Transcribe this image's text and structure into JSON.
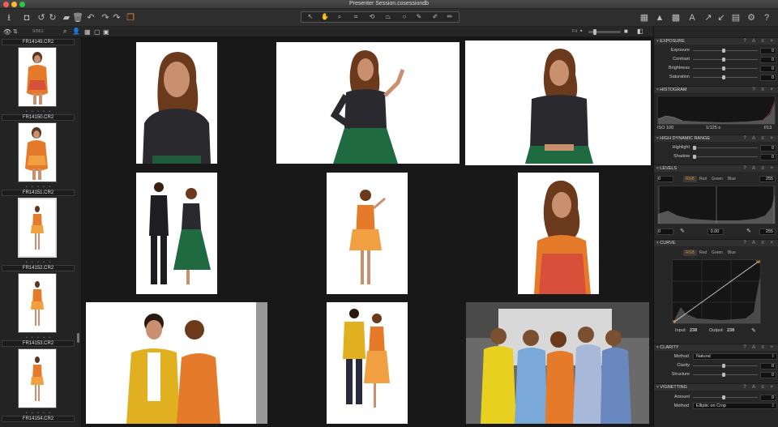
{
  "window": {
    "title": "Presenter Session.cosessiondb"
  },
  "toolbar": {
    "left_icons": [
      "import-icon",
      "capture-icon",
      "rotate-left-icon",
      "rotate-right-icon",
      "camera-icon",
      "trash-icon",
      "undo-icon",
      "redo-icon",
      "redo-alt-icon",
      "variants-icon"
    ],
    "cursor_tools": [
      "select-cursor-icon",
      "pan-hand-icon",
      "loupe-icon",
      "crop-icon",
      "rotate-tool-icon",
      "keystone-icon",
      "spot-icon",
      "color-picker-icon",
      "brush-icon",
      "eraser-icon"
    ],
    "right_icons": [
      "grid-view-icon",
      "warning-icon",
      "grid-icon",
      "text-icon",
      "copy-adjustments-icon",
      "apply-adjustments-icon",
      "print-icon",
      "settings-icon",
      "help-icon"
    ]
  },
  "subbar": {
    "count": "9/861",
    "fit_label": "Fit"
  },
  "browser": {
    "items": [
      {
        "name": "FR14149.CR2",
        "stars": "• • • • •"
      },
      {
        "name": "FR14150.CR2",
        "stars": "• • • • •"
      },
      {
        "name": "FR14151.CR2",
        "stars": "• • • • •"
      },
      {
        "name": "FR14152.CR2",
        "stars": "• • • • •"
      },
      {
        "name": "FR14153.CR2",
        "stars": "• • • • •"
      },
      {
        "name": "FR14154.CR2",
        "stars": ""
      }
    ]
  },
  "panels": {
    "exposure": {
      "title": "EXPOSURE",
      "rows": [
        {
          "label": "Exposure",
          "value": "0"
        },
        {
          "label": "Contrast",
          "value": "0"
        },
        {
          "label": "Brightness",
          "value": "0"
        },
        {
          "label": "Saturation",
          "value": "0"
        }
      ]
    },
    "histogram": {
      "title": "HISTOGRAM",
      "iso": "ISO 100",
      "shutter": "1/125 s",
      "aperture": "f/13"
    },
    "hdr": {
      "title": "HIGH DYNAMIC RANGE",
      "rows": [
        {
          "label": "Highlight",
          "value": "0"
        },
        {
          "label": "Shadow",
          "value": "0"
        }
      ]
    },
    "levels": {
      "title": "LEVELS",
      "low": "0",
      "high": "255",
      "tabs": [
        "RGB",
        "Red",
        "Green",
        "Blue"
      ],
      "out_low": "0",
      "mid": "0.00",
      "out_high": "255"
    },
    "curve": {
      "title": "CURVE",
      "tabs": [
        "RGB",
        "Red",
        "Green",
        "Blue"
      ],
      "input_label": "Input:",
      "input_value": "238",
      "output_label": "Output:",
      "output_value": "238"
    },
    "clarity": {
      "title": "CLARITY",
      "method_label": "Method",
      "method_value": "Natural",
      "rows": [
        {
          "label": "Clarity",
          "value": "0"
        },
        {
          "label": "Structure",
          "value": "0"
        }
      ]
    },
    "vignetting": {
      "title": "VIGNETTING",
      "rows": [
        {
          "label": "Amount",
          "value": "0"
        }
      ],
      "method_label": "Method",
      "method_value": "Elliptic on Crop"
    }
  }
}
